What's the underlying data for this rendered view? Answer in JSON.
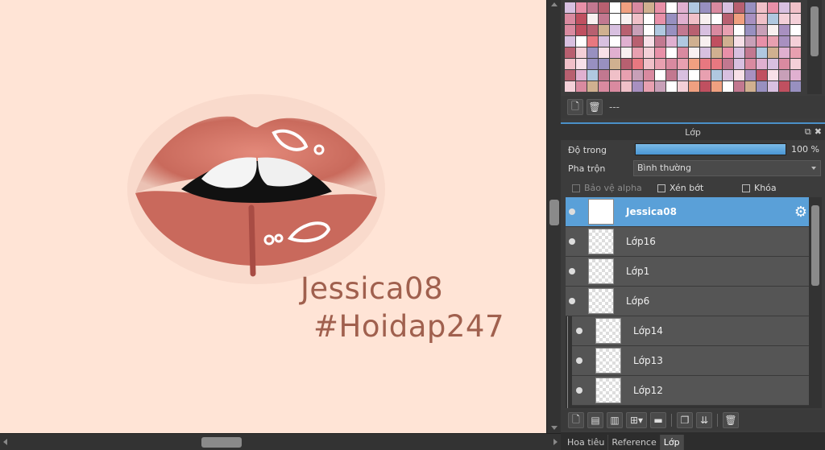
{
  "canvas": {
    "watermark_name": "Jessica08",
    "watermark_tag": "#Hoidap247",
    "background_color": "#ffe4d6"
  },
  "palette": {
    "extra_label": "---"
  },
  "layer_panel": {
    "title": "Lớp",
    "opacity_label": "Độ trong",
    "opacity_value": "100 %",
    "opacity_fraction": 1.0,
    "blend_label": "Pha trộn",
    "blend_value": "Bình thường",
    "protect_alpha_label": "Bảo vệ alpha",
    "clipping_label": "Xén bớt",
    "lock_label": "Khóa",
    "accent_color": "#5aa0d8",
    "layers": [
      {
        "name": "Jessica08",
        "selected": true
      },
      {
        "name": "Lớp16"
      },
      {
        "name": "Lớp1"
      },
      {
        "name": "Lớp6"
      },
      {
        "name": "Lớp14"
      },
      {
        "name": "Lớp13"
      },
      {
        "name": "Lớp12"
      }
    ]
  },
  "bottom_tabs": [
    "Hoa tiêu",
    "Reference",
    "Lớp"
  ]
}
